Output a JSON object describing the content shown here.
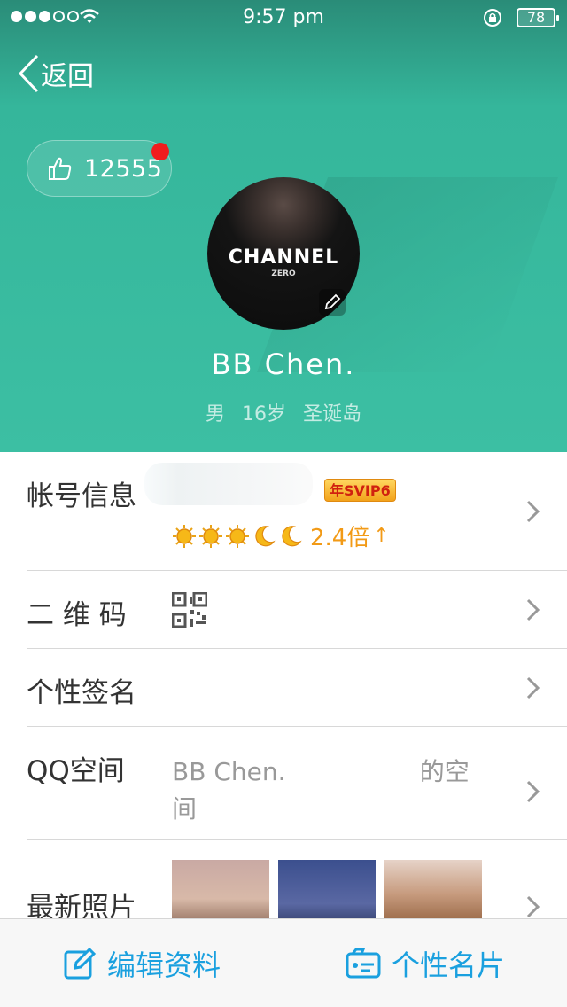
{
  "status_bar": {
    "time": "9:57 pm",
    "battery": "78"
  },
  "nav": {
    "back_label": "返回"
  },
  "profile": {
    "like_count": "12555",
    "avatar_text": "CHANNEL",
    "avatar_subtext": "ZERO",
    "nickname": "BB Chen.",
    "gender": "男",
    "age": "16岁",
    "location": "圣诞岛"
  },
  "rows": {
    "account": {
      "label": "帐号信息",
      "badge": "年SVIP6",
      "multiplier": "2.4倍",
      "level_icons": [
        "sun-icon",
        "sun-icon",
        "sun-icon",
        "moon-icon",
        "moon-icon"
      ]
    },
    "qrcode": {
      "label": "二 维 码"
    },
    "signature": {
      "label": "个性签名"
    },
    "qzone": {
      "label": "QQ空间",
      "value": "BB Chen.                 的空间"
    },
    "photos": {
      "label": "最新照片"
    }
  },
  "bottom_bar": {
    "edit_label": "编辑资料",
    "card_label": "个性名片"
  },
  "colors": {
    "header": "#3cbfa3",
    "accent": "#1aa0df",
    "badge_red": "#f01d1d",
    "level_orange": "#f29a16"
  }
}
